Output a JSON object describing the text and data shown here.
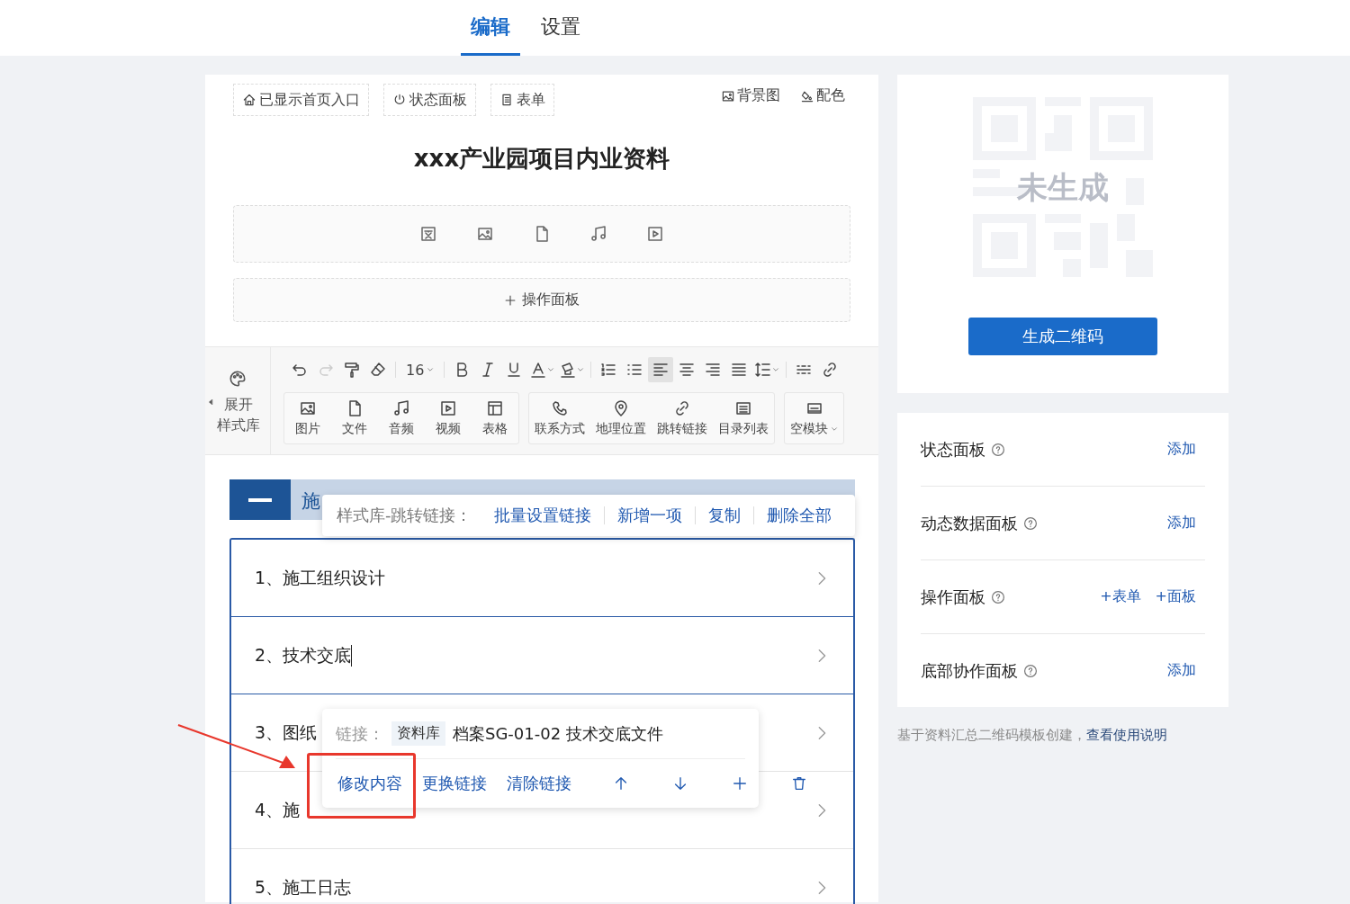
{
  "tabs": [
    {
      "label": "编辑",
      "selected": true
    },
    {
      "label": "设置",
      "selected": false
    }
  ],
  "editor": {
    "chips": [
      {
        "kind": "home",
        "label": "已显示首页入口"
      },
      {
        "kind": "status",
        "label": "状态面板"
      },
      {
        "kind": "form",
        "label": "表单"
      }
    ],
    "top_actions": [
      {
        "kind": "image",
        "label": "背景图"
      },
      {
        "kind": "paint",
        "label": "配色"
      }
    ],
    "title": "xxx产业园项目内业资料",
    "media": [
      {
        "kind": "text"
      },
      {
        "kind": "image"
      },
      {
        "kind": "file"
      },
      {
        "kind": "audio"
      },
      {
        "kind": "video"
      }
    ],
    "add_panel": "操作面板",
    "style_library": [
      "展开",
      "样式库"
    ],
    "format_buttons": [
      {
        "kind": "undo",
        "selected": false
      },
      {
        "kind": "redo",
        "selected": false
      },
      {
        "kind": "brush",
        "selected": false
      },
      {
        "kind": "eraser",
        "selected": false
      },
      {
        "kind": "size",
        "label": "16",
        "selected": false
      },
      {
        "kind": "bold",
        "selected": false
      },
      {
        "kind": "italic",
        "selected": false
      },
      {
        "kind": "underline",
        "selected": false
      },
      {
        "kind": "color",
        "selected": false
      },
      {
        "kind": "highlight",
        "selected": false
      },
      {
        "kind": "ol",
        "selected": false
      },
      {
        "kind": "ul",
        "selected": false
      },
      {
        "kind": "left",
        "selected": true
      },
      {
        "kind": "center",
        "selected": false
      },
      {
        "kind": "right",
        "selected": false
      },
      {
        "kind": "justify",
        "selected": false
      },
      {
        "kind": "lineheight",
        "selected": false
      },
      {
        "kind": "divider",
        "selected": false
      },
      {
        "kind": "link",
        "selected": false
      }
    ],
    "insert_groups": [
      [
        {
          "kind": "image",
          "label": "图片"
        },
        {
          "kind": "file",
          "label": "文件"
        },
        {
          "kind": "audio",
          "label": "音频"
        },
        {
          "kind": "video",
          "label": "视频"
        },
        {
          "kind": "table",
          "label": "表格"
        }
      ],
      [
        {
          "kind": "phone",
          "label": "联系方式"
        },
        {
          "kind": "pin",
          "label": "地理位置"
        },
        {
          "kind": "link",
          "label": "跳转链接"
        },
        {
          "kind": "list",
          "label": "目录列表"
        }
      ],
      [
        {
          "kind": "blank",
          "label": "空模块",
          "dropdown": true
        }
      ]
    ],
    "section_title": "施",
    "style_popup": {
      "label": "样式库-跳转链接：",
      "actions": [
        "批量设置链接",
        "新增一项",
        "复制",
        "删除全部"
      ]
    },
    "items": [
      {
        "text": "1、施工组织设计",
        "cursor": false
      },
      {
        "text": "2、技术交底",
        "cursor": true
      },
      {
        "text": "3、图纸",
        "cursor": false
      },
      {
        "text": "4、施",
        "cursor": false
      },
      {
        "text": "5、施工日志",
        "cursor": false
      }
    ],
    "link_popup": {
      "label": "链接：",
      "tag": "资料库",
      "target": "档案SG-01-02 技术交底文件",
      "actions": [
        "修改内容",
        "更换链接",
        "清除链接"
      ],
      "icon_actions": [
        {
          "kind": "up"
        },
        {
          "kind": "down"
        },
        {
          "kind": "plus"
        },
        {
          "kind": "delete"
        }
      ]
    }
  },
  "qr": {
    "placeholder": "未生成",
    "button": "生成二维码"
  },
  "panels": [
    {
      "label": "状态面板",
      "actions": [
        "添加"
      ]
    },
    {
      "label": "动态数据面板",
      "actions": [
        "添加"
      ]
    },
    {
      "label": "操作面板",
      "actions": [
        "+表单",
        "+面板"
      ]
    },
    {
      "label": "底部协作面板",
      "actions": [
        "添加"
      ]
    }
  ],
  "footer": {
    "text": "基于资料汇总二维码模板创建，",
    "link": "查看使用说明"
  }
}
